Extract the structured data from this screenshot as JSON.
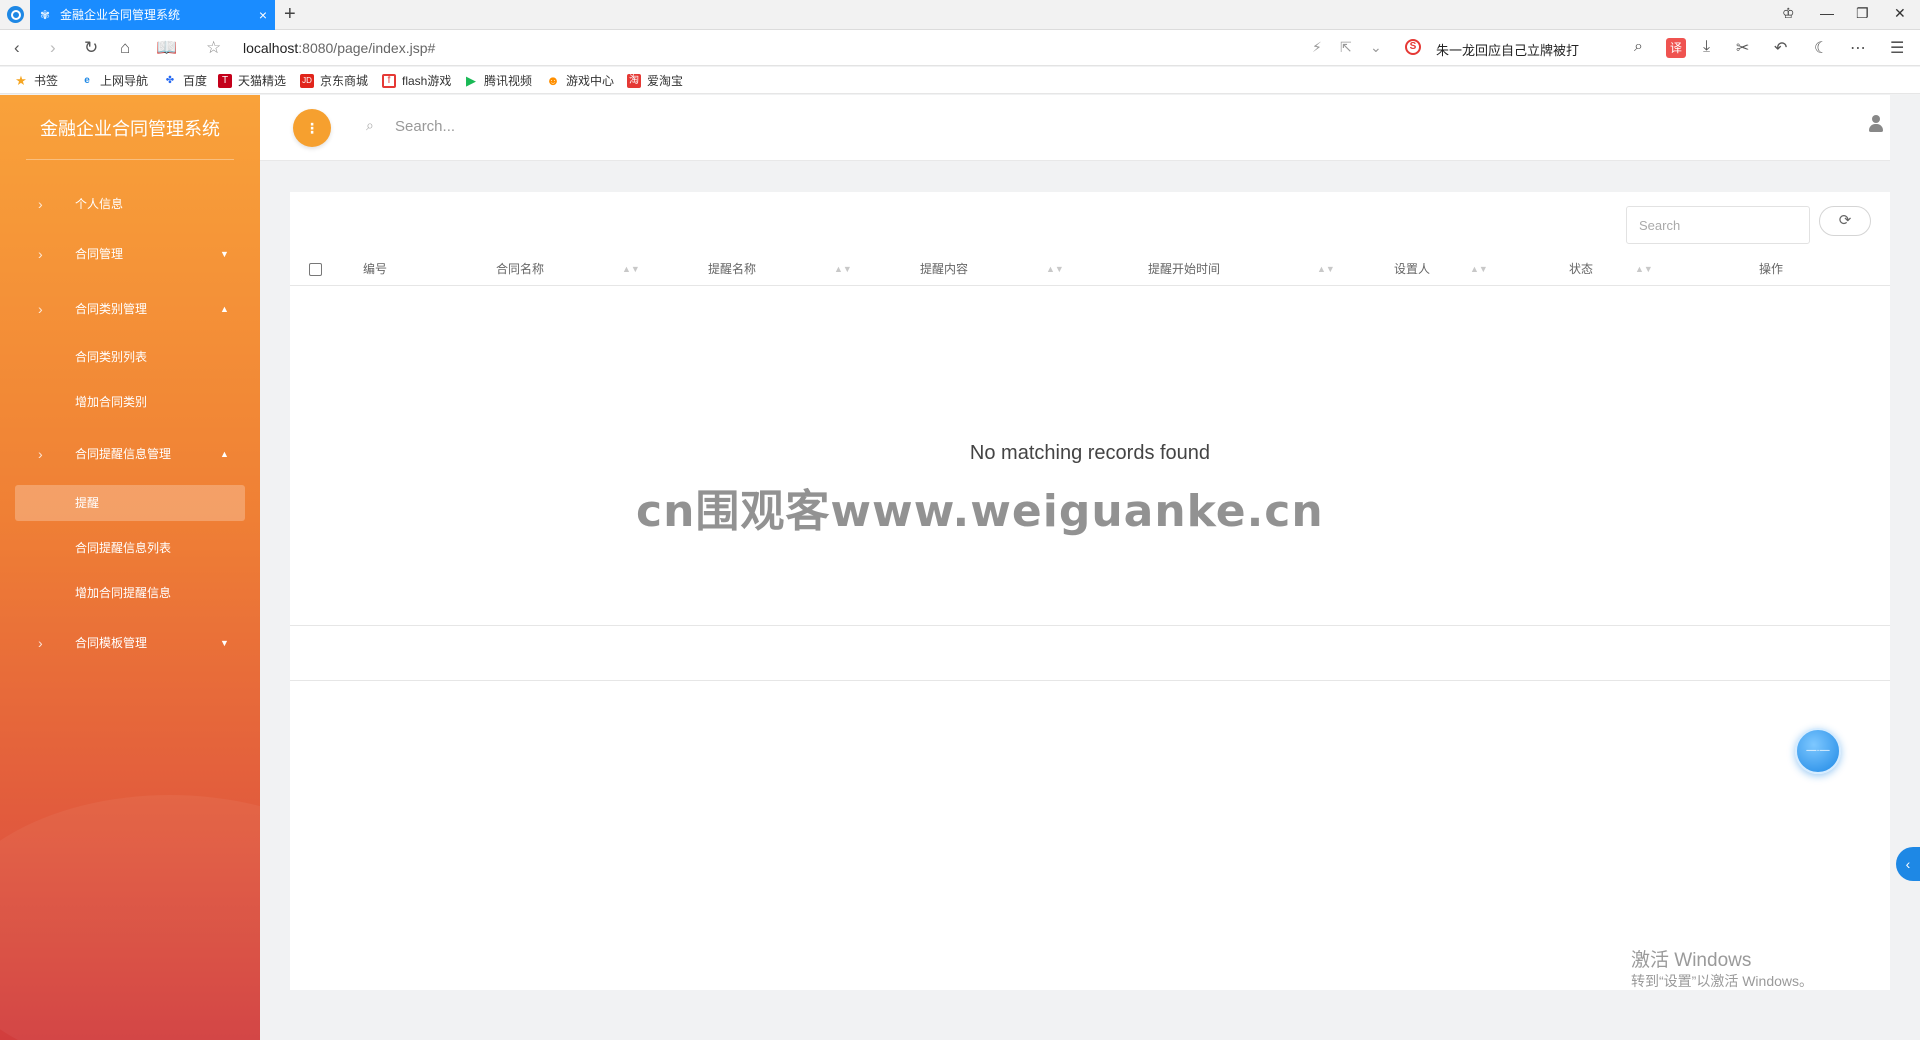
{
  "browser": {
    "tab_title": "金融企业合同管理系统",
    "tab_close": "×",
    "new_tab": "+",
    "url_host": "localhost",
    "url_rest": ":8080/page/index.jsp#",
    "news_text": "朱一龙回应自己立牌被打",
    "search_engine_letter": "S",
    "translate_label": "译"
  },
  "bookmarks": [
    {
      "label": "书签",
      "icon": "star-icon",
      "color": "#f5a623"
    },
    {
      "label": "上网导航",
      "icon": "e-icon",
      "color": "#1e88e5"
    },
    {
      "label": "百度",
      "icon": "baidu-paw-icon",
      "color": "#2468f2"
    },
    {
      "label": "天猫精选",
      "icon": "tmall-icon",
      "color": "#c4001a"
    },
    {
      "label": "京东商城",
      "icon": "jd-icon",
      "color": "#e1251b"
    },
    {
      "label": "flash游戏",
      "icon": "flash-icon",
      "color": "#e53935"
    },
    {
      "label": "腾讯视频",
      "icon": "tencent-video-icon",
      "color": "#19b955"
    },
    {
      "label": "游戏中心",
      "icon": "game-center-icon",
      "color": "#ff8f00"
    },
    {
      "label": "爱淘宝",
      "icon": "aitaobao-icon",
      "color": "#e53935"
    }
  ],
  "sidebar": {
    "brand": "金融企业合同管理系统",
    "items": [
      {
        "label": "个人信息"
      },
      {
        "label": "合同管理"
      },
      {
        "label": "合同类别管理"
      },
      {
        "label": "合同类别列表"
      },
      {
        "label": "增加合同类别"
      },
      {
        "label": "合同提醒信息管理"
      },
      {
        "label": "提醒"
      },
      {
        "label": "合同提醒信息列表"
      },
      {
        "label": "增加合同提醒信息"
      },
      {
        "label": "合同模板管理"
      }
    ]
  },
  "topbar": {
    "search_placeholder": "Search..."
  },
  "table": {
    "search_placeholder": "Search",
    "columns": [
      "编号",
      "合同名称",
      "提醒名称",
      "提醒内容",
      "提醒开始时间",
      "设置人",
      "状态",
      "操作"
    ],
    "empty_message": "No matching records found"
  },
  "overlay": {
    "watermark": "cn围观客www.weiguanke.cn",
    "activate_title": "激活 Windows",
    "activate_sub": "转到“设置”以激活 Windows。"
  },
  "colors": {
    "accent": "#f6a02f",
    "sidebar_top": "#f9a23a",
    "sidebar_bottom": "#d13d3d",
    "browser_tab": "#1a8cff"
  }
}
